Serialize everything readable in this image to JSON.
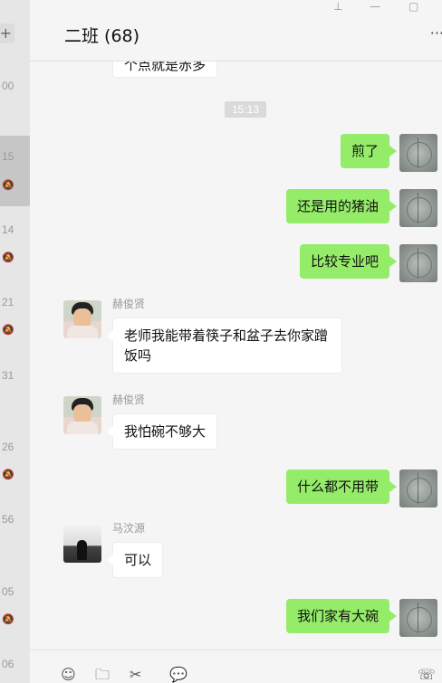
{
  "sidebar": {
    "plus_label": "+",
    "times": [
      "00",
      "15",
      "14",
      "21",
      "31",
      "26",
      "56",
      "05",
      "06"
    ],
    "mute_icon": "🔕"
  },
  "header": {
    "title": "二班 (68)",
    "more": "···"
  },
  "window_controls": {
    "pin": "⊥",
    "minimize": "—",
    "maximize": "▢"
  },
  "messages": {
    "partial_top": "个点就是赤多",
    "time_chip": "15:13",
    "m1": "煎了",
    "m2": "还是用的猪油",
    "m3": "比较专业吧",
    "sender1": "赫俊贤",
    "m4": "老师我能带着筷子和盆子去你家蹭饭吗",
    "sender2": "赫俊贤",
    "m5": "我怕碗不够大",
    "m6": "什么都不用带",
    "sender3": "马汶源",
    "m7": "可以",
    "m8": "我们家有大碗"
  },
  "toolbar": {
    "emoji_icon": "☺",
    "folder_icon": "🗀",
    "scissors_icon": "✂",
    "chat_icon": "💬",
    "phone_icon": "☏"
  }
}
